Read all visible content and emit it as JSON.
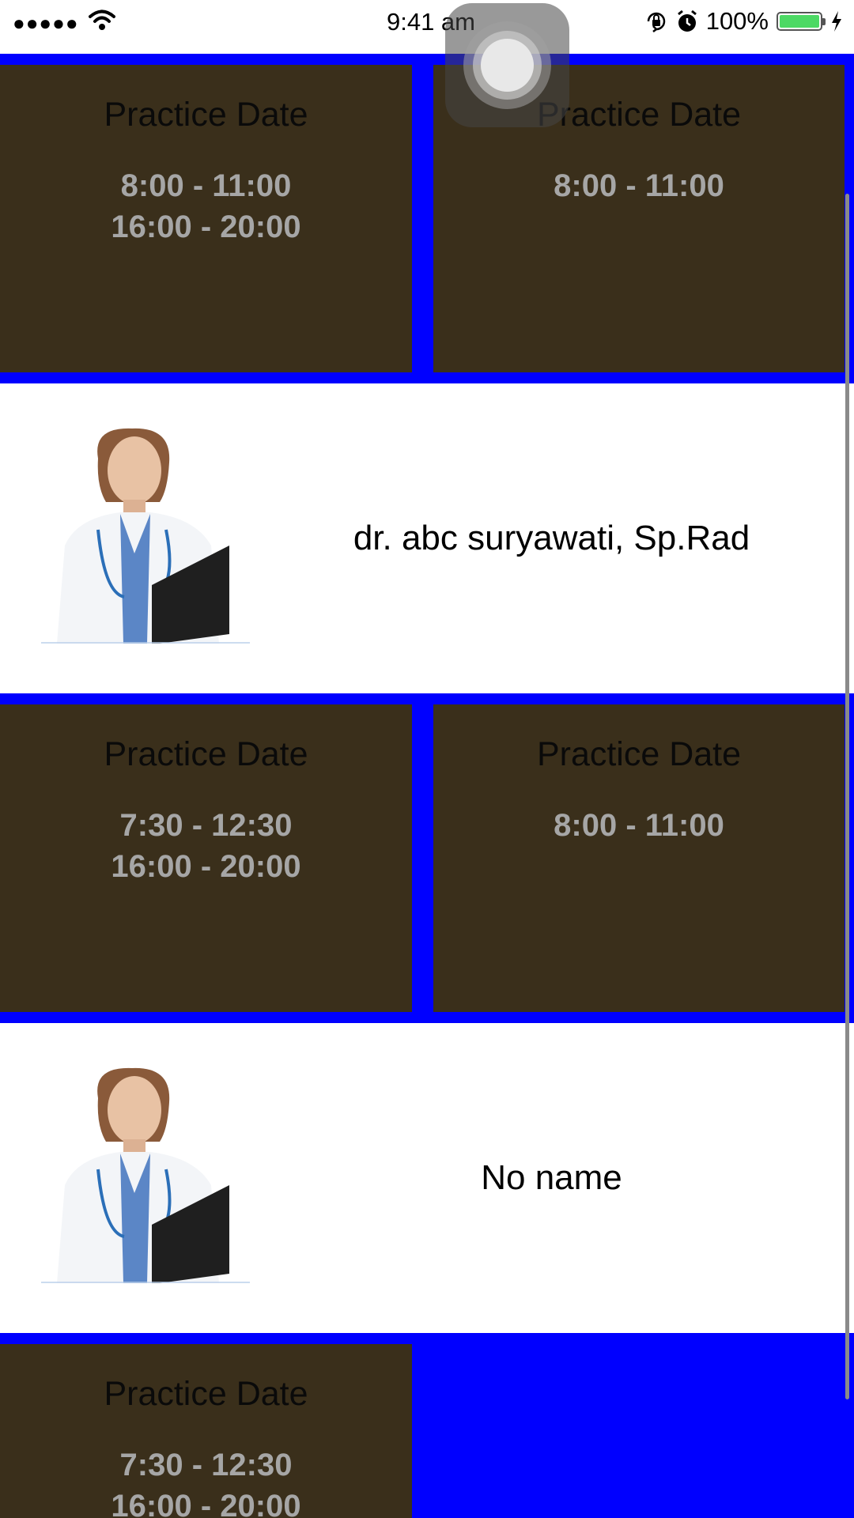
{
  "status_bar": {
    "signal": "●●●●●",
    "time": "9:41 am",
    "battery_percent": "100%",
    "battery_level": 1.0,
    "icons": [
      "signal-dots-icon",
      "wifi-icon",
      "rotation-lock-icon",
      "alarm-icon",
      "battery-icon",
      "charging-bolt-icon"
    ]
  },
  "colors": {
    "schedule_background": "#0000ff",
    "card_background": "#3a2f1b",
    "card_title": "#0a0a0a",
    "card_time": "#a6a6a6",
    "battery_fill": "#4cd964"
  },
  "schedules": [
    {
      "cards": [
        {
          "title": "Practice Date",
          "times": [
            "8:00 - 11:00",
            "16:00 - 20:00"
          ]
        },
        {
          "title": "Practice Date",
          "times": [
            "8:00 - 11:00"
          ]
        }
      ]
    },
    {
      "cards": [
        {
          "title": "Practice Date",
          "times": [
            "7:30 - 12:30",
            "16:00 - 20:00"
          ]
        },
        {
          "title": "Practice Date",
          "times": [
            "8:00 - 11:00"
          ]
        }
      ]
    },
    {
      "cards": [
        {
          "title": "Practice Date",
          "times": [
            "7:30 - 12:30",
            "16:00 - 20:00"
          ]
        }
      ]
    }
  ],
  "doctors": [
    {
      "name": "dr. abc suryawati, Sp.Rad",
      "photo_icon": "doctor-photo"
    },
    {
      "name": "No name",
      "photo_icon": "doctor-photo"
    }
  ]
}
